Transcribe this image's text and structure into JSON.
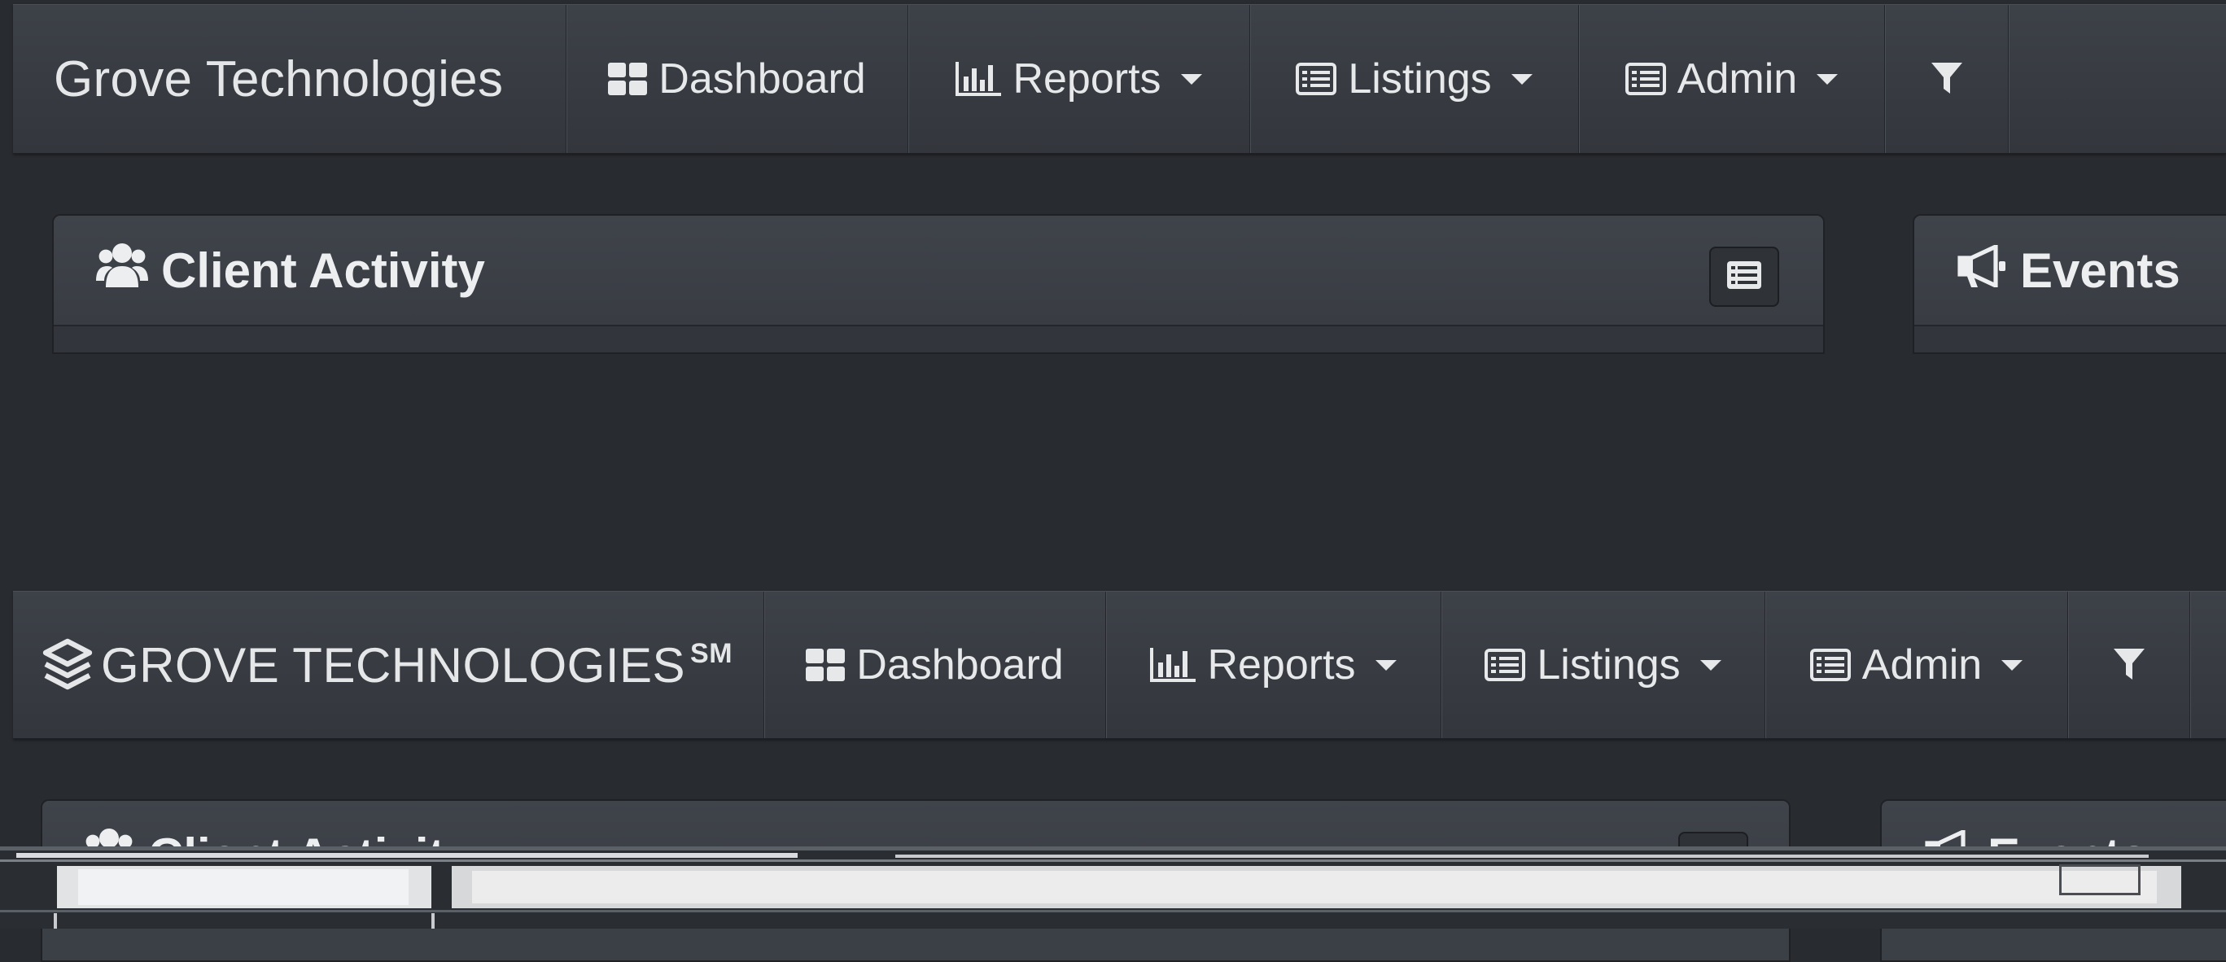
{
  "navbar_top": {
    "brand": "Grove Technologies",
    "items": [
      {
        "label": "Dashboard",
        "icon": "dashboard-icon"
      },
      {
        "label": "Reports",
        "icon": "bar-chart-icon"
      },
      {
        "label": "Listings",
        "icon": "list-icon"
      },
      {
        "label": "Admin",
        "icon": "list-icon"
      }
    ],
    "filter_icon": "filter-icon"
  },
  "navbar_bottom": {
    "brand": "GROVE TECHNOLOGIES",
    "brand_mark": "SM",
    "items": [
      {
        "label": "Dashboard",
        "icon": "dashboard-icon"
      },
      {
        "label": "Reports",
        "icon": "bar-chart-icon"
      },
      {
        "label": "Listings",
        "icon": "list-icon"
      },
      {
        "label": "Admin",
        "icon": "list-icon"
      }
    ],
    "filter_icon": "filter-icon"
  },
  "panels": {
    "client_activity": {
      "title": "Client Activity",
      "icon": "users-icon"
    },
    "events": {
      "title": "Events",
      "icon": "bullhorn-icon"
    }
  },
  "colors": {
    "background": "#282b30",
    "navbar": "#393c43",
    "panel_header": "#3b3f46",
    "text": "#e8e9eb"
  }
}
